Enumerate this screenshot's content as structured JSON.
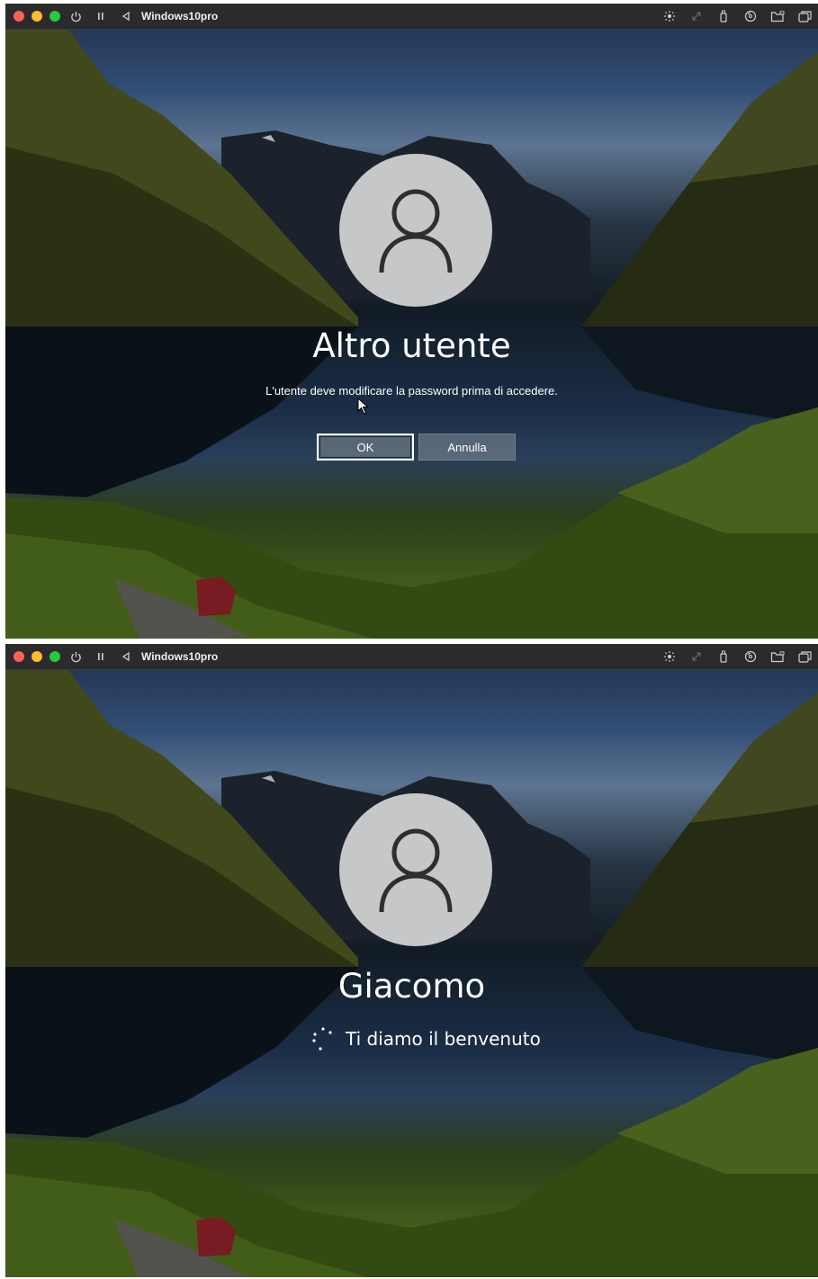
{
  "colors": {
    "titlebar": "#2b2b2d",
    "traffic_red": "#ff5f57",
    "traffic_yellow": "#febc2e",
    "traffic_green": "#28c840",
    "avatar_bg": "#c6c7c9",
    "avatar_glyph": "#2f2f30",
    "button_bg": "#828c96"
  },
  "windows": [
    {
      "title": "Windows10pro",
      "toolbar_icons": [
        "power-icon",
        "pause-icon",
        "back-icon"
      ],
      "right_icons": [
        "brightness-icon",
        "resize-icon",
        "usb-icon",
        "cd-icon",
        "folder-icon",
        "windows-icon"
      ],
      "login": {
        "user_name": "Altro utente",
        "message": "L'utente deve modificare la password prima di accedere.",
        "ok_label": "OK",
        "cancel_label": "Annulla"
      }
    },
    {
      "title": "Windows10pro",
      "toolbar_icons": [
        "power-icon",
        "pause-icon",
        "back-icon"
      ],
      "right_icons": [
        "brightness-icon",
        "resize-icon",
        "usb-icon",
        "cd-icon",
        "folder-icon",
        "windows-icon"
      ],
      "login": {
        "user_name": "Giacomo",
        "status": "Ti diamo il benvenuto"
      }
    }
  ]
}
